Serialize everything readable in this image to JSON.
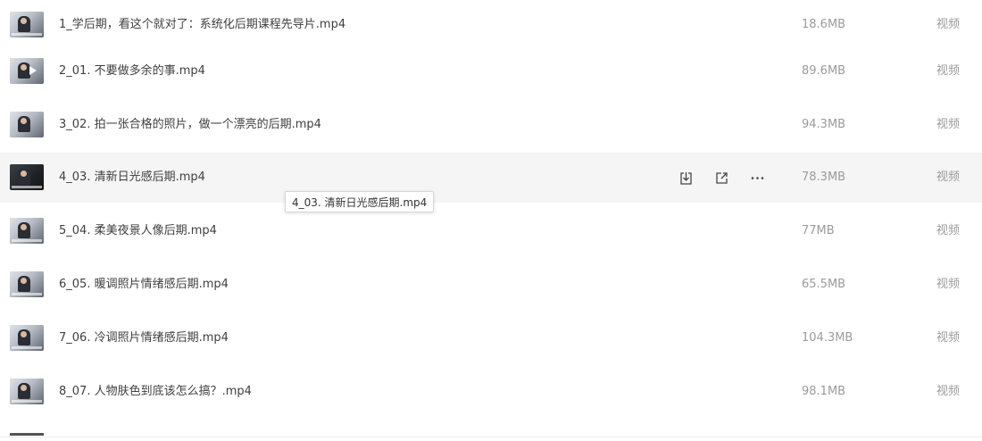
{
  "files": [
    {
      "name": "1_学后期，看这个就对了：系统化后期课程先导片.mp4",
      "size": "18.6MB",
      "type": "视频"
    },
    {
      "name": "2_01. 不要做多余的事.mp4",
      "size": "89.6MB",
      "type": "视频"
    },
    {
      "name": "3_02. 拍一张合格的照片，做一个漂亮的后期.mp4",
      "size": "94.3MB",
      "type": "视频"
    },
    {
      "name": "4_03. 清新日光感后期.mp4",
      "size": "78.3MB",
      "type": "视频"
    },
    {
      "name": "5_04. 柔美夜景人像后期.mp4",
      "size": "77MB",
      "type": "视频"
    },
    {
      "name": "6_05. 暖调照片情绪感后期.mp4",
      "size": "65.5MB",
      "type": "视频"
    },
    {
      "name": "7_06. 冷调照片情绪感后期.mp4",
      "size": "104.3MB",
      "type": "视频"
    },
    {
      "name": "8_07. 人物肤色到底该怎么搞？.mp4",
      "size": "98.1MB",
      "type": "视频"
    }
  ],
  "hovered_row_index": 3,
  "row_actions": {
    "download_icon": "download-icon",
    "share_icon": "share-icon",
    "more_icon": "more-icon"
  },
  "tooltip": {
    "text": "4_03. 清新日光感后期.mp4"
  },
  "colors": {
    "hover_background": "#f5f5f6",
    "secondary_text": "#9b9b9b",
    "primary_text": "#3f3f3f"
  }
}
